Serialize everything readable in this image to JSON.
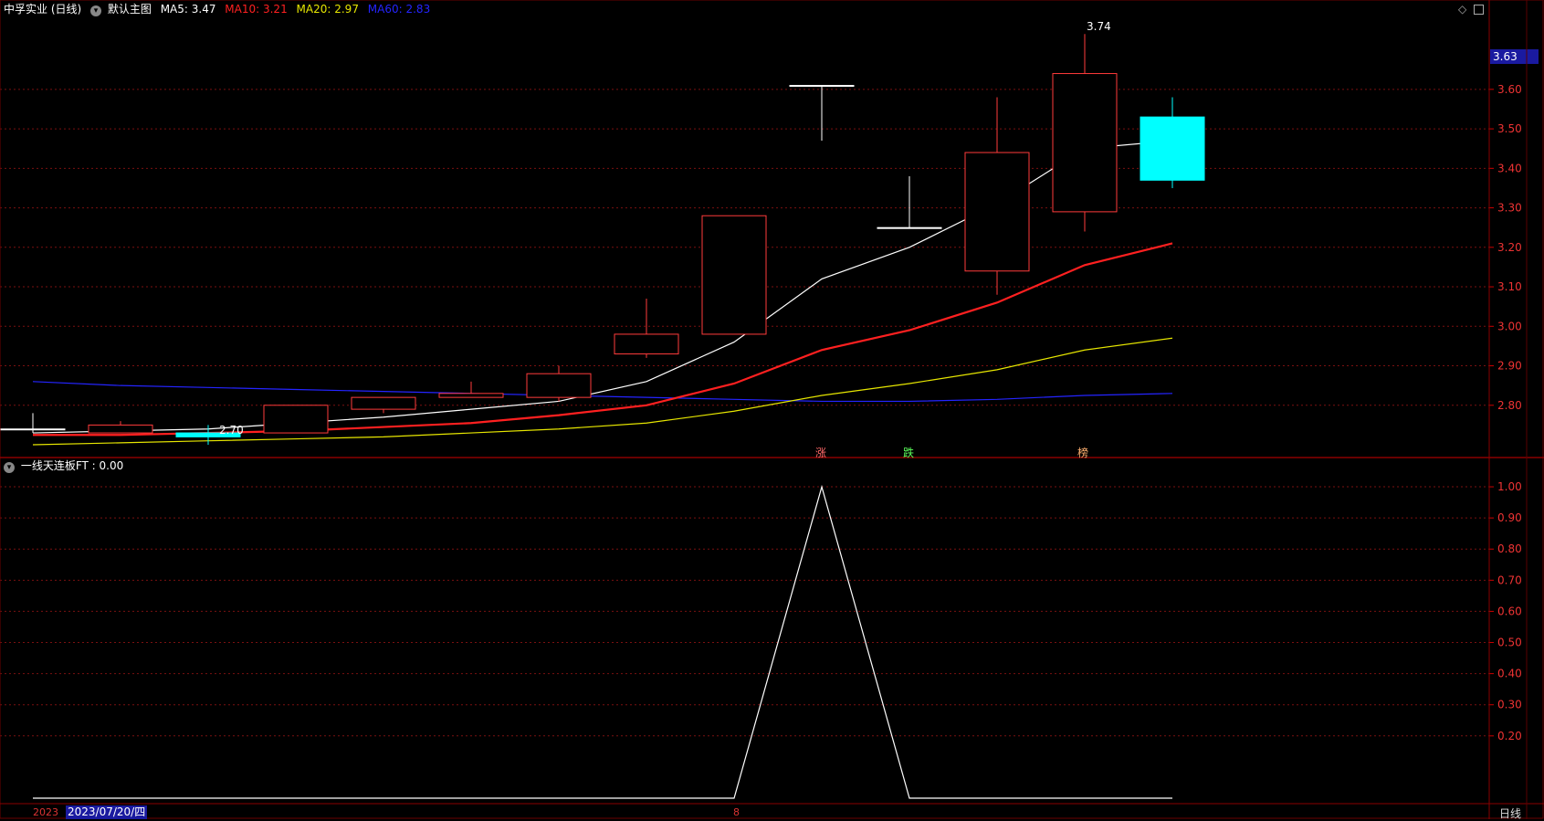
{
  "header": {
    "stock_name": "中孚实业 (日线)",
    "chart_mode": "默认主图",
    "ma5": "MA5: 3.47",
    "ma10": "MA10: 3.21",
    "ma20": "MA20: 2.97",
    "ma60": "MA60: 2.83"
  },
  "indicator": {
    "label": "一线天连板FT : 0.00"
  },
  "price_axis": {
    "current_price": "3.63",
    "ticks": [
      "3.60",
      "3.50",
      "3.40",
      "3.30",
      "3.20",
      "3.10",
      "3.00",
      "2.90",
      "2.80"
    ]
  },
  "sub_axis": {
    "ticks": [
      "1.00",
      "0.90",
      "0.80",
      "0.70",
      "0.60",
      "0.50",
      "0.40",
      "0.30",
      "0.20"
    ]
  },
  "annotations": {
    "high": "3.74",
    "low": "2.70",
    "zhang": "涨",
    "die": "跌",
    "bang": "榜"
  },
  "footer": {
    "date_prefix": "2023",
    "cursor_date": "2023/07/20/四",
    "month_mark": "8",
    "period": "日线"
  },
  "colors": {
    "up": "#ff3b3b",
    "down": "#00ffff",
    "ma5": "#ffffff",
    "ma10": "#ff2020",
    "ma20": "#e6e600",
    "ma60": "#2424ff",
    "grid": "#7a1010"
  },
  "chart_data": {
    "type": "candlestick",
    "candles": [
      {
        "o": 2.74,
        "h": 2.78,
        "l": 2.73,
        "c": 2.74
      },
      {
        "o": 2.73,
        "h": 2.76,
        "l": 2.73,
        "c": 2.75
      },
      {
        "o": 2.73,
        "h": 2.75,
        "l": 2.7,
        "c": 2.72
      },
      {
        "o": 2.73,
        "h": 2.8,
        "l": 2.73,
        "c": 2.8
      },
      {
        "o": 2.79,
        "h": 2.82,
        "l": 2.78,
        "c": 2.82
      },
      {
        "o": 2.82,
        "h": 2.86,
        "l": 2.82,
        "c": 2.83
      },
      {
        "o": 2.82,
        "h": 2.9,
        "l": 2.81,
        "c": 2.88
      },
      {
        "o": 2.93,
        "h": 3.07,
        "l": 2.92,
        "c": 2.98
      },
      {
        "o": 2.98,
        "h": 3.28,
        "l": 2.98,
        "c": 3.28
      },
      {
        "o": 3.61,
        "h": 3.61,
        "l": 3.47,
        "c": 3.61
      },
      {
        "o": 3.25,
        "h": 3.38,
        "l": 3.25,
        "c": 3.25
      },
      {
        "o": 3.14,
        "h": 3.58,
        "l": 3.08,
        "c": 3.44
      },
      {
        "o": 3.29,
        "h": 3.74,
        "l": 3.24,
        "c": 3.64
      },
      {
        "o": 3.53,
        "h": 3.58,
        "l": 3.35,
        "c": 3.37
      }
    ],
    "ma5": [
      2.73,
      2.735,
      2.74,
      2.755,
      2.77,
      2.79,
      2.81,
      2.86,
      2.96,
      3.12,
      3.2,
      3.31,
      3.45,
      3.47
    ],
    "ma10": [
      2.725,
      2.725,
      2.73,
      2.735,
      2.745,
      2.755,
      2.775,
      2.8,
      2.855,
      2.94,
      2.99,
      3.06,
      3.155,
      3.21
    ],
    "ma20": [
      2.7,
      2.705,
      2.71,
      2.715,
      2.72,
      2.73,
      2.74,
      2.755,
      2.785,
      2.825,
      2.855,
      2.89,
      2.94,
      2.97
    ],
    "ma60": [
      2.86,
      2.85,
      2.845,
      2.84,
      2.835,
      2.83,
      2.825,
      2.82,
      2.815,
      2.81,
      2.81,
      2.815,
      2.825,
      2.83
    ],
    "indicator_values": [
      0,
      0,
      0,
      0,
      0,
      0,
      0,
      0,
      0,
      1,
      0,
      0,
      0,
      0
    ],
    "price_range": [
      2.67,
      3.78
    ],
    "indicator_range": [
      0,
      1.05
    ]
  }
}
